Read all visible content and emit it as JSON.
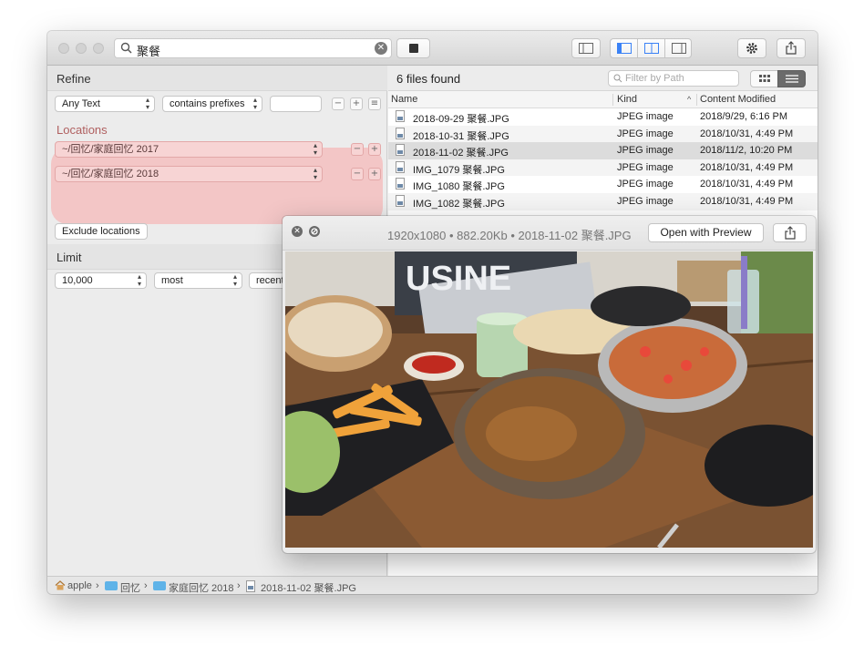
{
  "toolbar": {
    "search_query": "聚餐",
    "clear_symbol": "✕"
  },
  "refine": {
    "title": "Refine",
    "text_type": "Any Text",
    "match_mode": "contains prefixes",
    "term_value": "",
    "minus": "−",
    "plus": "+",
    "menu": "≡"
  },
  "locations": {
    "title": "Locations",
    "items": [
      "~/回忆/家庭回忆 2017",
      "~/回忆/家庭回忆 2018"
    ],
    "exclude_label": "Exclude locations"
  },
  "limit": {
    "title": "Limit",
    "count": "10,000",
    "order": "most",
    "by": "recent"
  },
  "results": {
    "count_label": "6 files found",
    "filter_placeholder": "Filter by Path",
    "columns": {
      "name": "Name",
      "kind": "Kind",
      "modified": "Content Modified",
      "sort_arrow": "^"
    },
    "rows": [
      {
        "name": "2018-09-29 聚餐.JPG",
        "kind": "JPEG image",
        "modified": "2018/9/29, 6:16 PM",
        "selected": false
      },
      {
        "name": "2018-10-31 聚餐.JPG",
        "kind": "JPEG image",
        "modified": "2018/10/31, 4:49 PM",
        "selected": false
      },
      {
        "name": "2018-11-02 聚餐.JPG",
        "kind": "JPEG image",
        "modified": "2018/11/2, 10:20 PM",
        "selected": true
      },
      {
        "name": "IMG_1079 聚餐.JPG",
        "kind": "JPEG image",
        "modified": "2018/10/31, 4:49 PM",
        "selected": false
      },
      {
        "name": "IMG_1080 聚餐.JPG",
        "kind": "JPEG image",
        "modified": "2018/10/31, 4:49 PM",
        "selected": false
      },
      {
        "name": "IMG_1082 聚餐.JPG",
        "kind": "JPEG image",
        "modified": "2018/10/31, 4:49 PM",
        "selected": false
      }
    ]
  },
  "pathbar": {
    "segments": [
      "apple",
      "回忆",
      "家庭回忆 2018",
      "2018-11-02 聚餐.JPG"
    ],
    "separator": "›"
  },
  "quicklook": {
    "info": "1920x1080 • 882.20Kb • 2018-11-02 聚餐.JPG",
    "open_label": "Open with Preview",
    "photo_text": "USINE",
    "close_symbol": "✕"
  },
  "colors": {
    "locations_highlight": "#f3c6c6",
    "selected_row": "#dcdcdc",
    "toggle_blue": "#3b82f6",
    "folder_blue": "#5fb3e8"
  }
}
